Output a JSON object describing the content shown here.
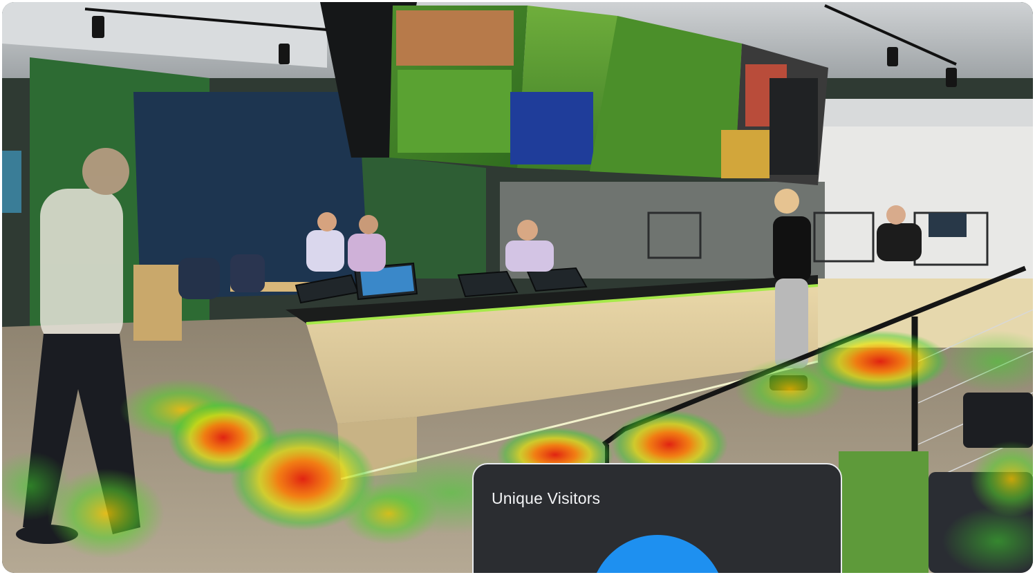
{
  "card": {
    "title": "Unique Visitors",
    "gauge_color": "#1e90f0"
  },
  "scene": {
    "description_free": true,
    "icons": [
      "heatmap-overlay",
      "tv-screens"
    ]
  }
}
